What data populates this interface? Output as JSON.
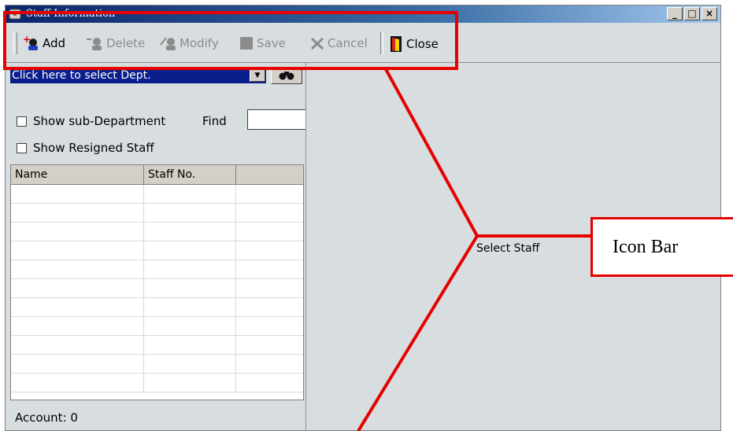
{
  "window": {
    "title": "Staff Information",
    "controls": [
      "_",
      "□",
      "×"
    ]
  },
  "toolbar": {
    "buttons": [
      {
        "label": "Add",
        "icon": "add-user-icon",
        "enabled": true
      },
      {
        "label": "Delete",
        "icon": "delete-user-icon",
        "enabled": false
      },
      {
        "label": "Modify",
        "icon": "modify-user-icon",
        "enabled": false
      },
      {
        "label": "Save",
        "icon": "save-icon",
        "enabled": false
      },
      {
        "label": "Cancel",
        "icon": "cancel-icon",
        "enabled": false
      },
      {
        "label": "Close",
        "icon": "exit-door-icon",
        "enabled": true
      }
    ]
  },
  "left_panel": {
    "dept_select": "Click here to select Dept.",
    "show_sub_department": "Show sub-Department",
    "show_resigned": "Show Resigned Staff",
    "find_label": "Find",
    "find_value": "",
    "columns": [
      "Name",
      "Staff No.",
      ""
    ],
    "rows": 11,
    "account": "Account: 0"
  },
  "right_panel": {
    "placeholder": "Select Staff"
  },
  "annotation": {
    "callout": "Icon Bar",
    "color": "#e60000"
  },
  "colors": {
    "titlebar": "#0a246a",
    "dept_select_bg": "#0a1e8c",
    "panel_bg": "#d8dde0"
  }
}
